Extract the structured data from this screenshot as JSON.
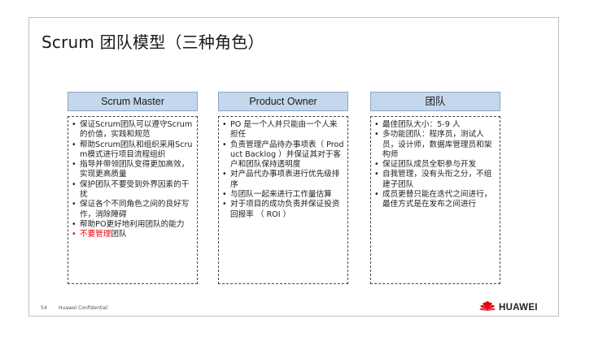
{
  "slide": {
    "title": "Scrum 团队模型（三种角色）",
    "page_number": "54",
    "confidential": "Huawei Confidential",
    "logo_text": "HUAWEI",
    "brand_color": "#e60012",
    "header_color": "#c5d7ec"
  },
  "columns": [
    {
      "heading": "Scrum Master",
      "items": [
        {
          "text": "保证Scrum团队可以遵守Scrum的价值，实践和规范"
        },
        {
          "text": "帮助Scrum团队和组织采用Scrum模式进行项目流程组织"
        },
        {
          "text": "指导并带领团队变得更加高效，实现更高质量"
        },
        {
          "text": "保护团队不要受到外界因素的干扰"
        },
        {
          "text": "保证各个不同角色之间的良好写作，消除障碍"
        },
        {
          "text": "帮助PO更好地利用团队的能力"
        },
        {
          "highlight": "不要管理",
          "text": "团队"
        }
      ]
    },
    {
      "heading": "Product Owner",
      "items": [
        {
          "text": "PO 是一个人并只能由一个人来担任"
        },
        {
          "text": "负责管理产品待办事项表（ Product Backlog ）并保证其对于客户和团队保持透明度"
        },
        {
          "text": "对产品代办事项表进行优先级排序"
        },
        {
          "text": "与团队一起来进行工作量估算"
        },
        {
          "text": "对于项目的成功负责并保证投资回报率 （ ROI ）"
        }
      ]
    },
    {
      "heading": "团队",
      "items": [
        {
          "text": "最佳团队大小：5-9 人"
        },
        {
          "text": "多功能团队：程序员，测试人员，设计师，数据库管理员和架构师"
        },
        {
          "text": "保证团队成员全职参与开发"
        },
        {
          "text": "自我管理，没有头衔之分，不组建子团队"
        },
        {
          "text": "成员更替只能在迭代之间进行，最佳方式是在发布之间进行"
        }
      ]
    }
  ]
}
